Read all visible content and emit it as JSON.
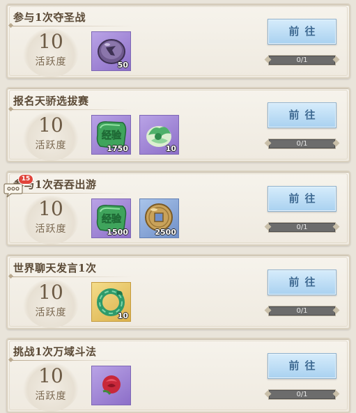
{
  "tasks": [
    {
      "title": "参与1次夺圣战",
      "points": "10",
      "points_label": "活跃度",
      "button_label": "前往",
      "progress_text": "0/1",
      "progress_fraction": 0,
      "rewards": [
        {
          "icon": "amethyst-stone-icon",
          "count": "50",
          "rarity_color": "#9a80d6"
        }
      ]
    },
    {
      "title": "报名天骄选拔赛",
      "points": "10",
      "points_label": "活跃度",
      "button_label": "前往",
      "progress_text": "0/1",
      "progress_fraction": 0,
      "rewards": [
        {
          "icon": "experience-jade-icon",
          "icon_text": "经验",
          "count": "1750",
          "rarity_color": "#9a80d6"
        },
        {
          "icon": "jade-cabbage-icon",
          "count": "10",
          "rarity_color": "#9a80d6"
        }
      ]
    },
    {
      "title": "参与1次吞吞出游",
      "points": "10",
      "points_label": "活跃度",
      "button_label": "前往",
      "progress_text": "0/1",
      "progress_fraction": 0,
      "rewards": [
        {
          "icon": "experience-jade-icon",
          "icon_text": "经验",
          "count": "1500",
          "rarity_color": "#9a80d6"
        },
        {
          "icon": "copper-coin-icon",
          "count": "2500",
          "rarity_color": "#7f9dd2"
        }
      ]
    },
    {
      "title": "世界聊天发言1次",
      "points": "10",
      "points_label": "活跃度",
      "button_label": "前往",
      "progress_text": "0/1",
      "progress_fraction": 0,
      "rewards": [
        {
          "icon": "jade-dragon-ring-icon",
          "count": "10",
          "rarity_color": "#e5c261"
        }
      ]
    },
    {
      "title": "挑战1次万域斗法",
      "points": "10",
      "points_label": "活跃度",
      "button_label": "前往",
      "progress_text": "0/1",
      "progress_fraction": 0,
      "rewards": [
        {
          "icon": "red-rose-icon",
          "count": "",
          "rarity_color": "#9a80d6"
        }
      ]
    }
  ],
  "chat_widget": {
    "icon": "chat-bubble-icon",
    "unread_count": "15",
    "badge_color": "#e0443a"
  }
}
